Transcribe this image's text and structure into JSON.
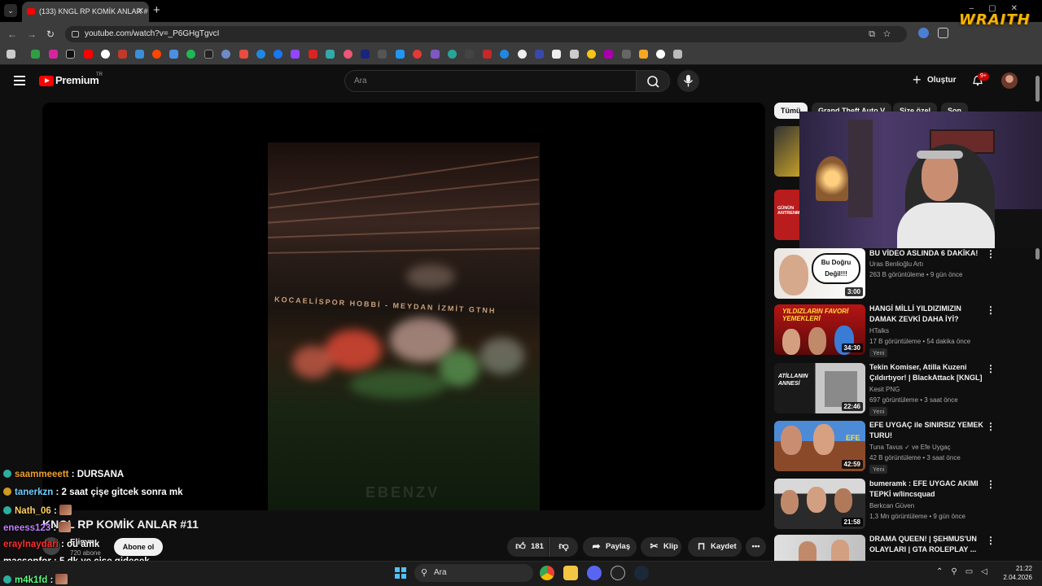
{
  "browser": {
    "tab_title": "(133) KNGL RP KOMİK ANLAR #",
    "url": "youtube.com/watch?v=_P6GHgTgvcI"
  },
  "overlay": {
    "wraith_logo": "WRAITH"
  },
  "youtube": {
    "logo_text": "Premium",
    "country_code": "TR",
    "search_placeholder": "Ara",
    "create_label": "Oluştur",
    "notification_badge": "9+"
  },
  "video": {
    "title": "KNGL RP KOMİK ANLAR #11",
    "banner_text": "KOCAELİSPOR HOBBİ - MEYDAN İZMİT GTNH",
    "channel": "Elimm",
    "subscribers": "720 abone",
    "subscribe_label": "Abone ol",
    "likes": "181",
    "share_label": "Paylaş",
    "clip_label": "Klip",
    "save_label": "Kaydet"
  },
  "chat": [
    {
      "user": "saammeeett",
      "message": ": DURSANA",
      "color": "#f0a030",
      "badge": "#2bb0a0"
    },
    {
      "user": "tanerkzn",
      "message": ": 2 saat çişe gitcek sonra mk",
      "color": "#70d0ff",
      "badge": "#d09a20"
    },
    {
      "user": "Nath_06",
      "message": ":",
      "color": "#ffd060",
      "badge": "#2bb0a0",
      "emote": true
    },
    {
      "user": "eneess123",
      "message": ":",
      "color": "#c080ff",
      "badge": "",
      "emote": true
    },
    {
      "user": "eraylnaydari",
      "message": ": ou amk",
      "color": "#ff3030",
      "badge": ""
    },
    {
      "user": "macsonfor",
      "message": ": 5 dk ye çişe gidecek",
      "color": "#ffffff",
      "badge": ""
    },
    {
      "user": "m4k1fd",
      "message": ":",
      "color": "#60ff80",
      "badge": "#2bb0a0",
      "emote": true
    }
  ],
  "chips": [
    "Tümü",
    "Grand Theft Auto V",
    "Size özel",
    "Son"
  ],
  "recommendations": [
    {
      "title": "BU VİDEO ASLINDA 6 DAKİKA!",
      "thumb_text": "Bu Doğru Değil!!!",
      "channel": "Uras Benlioğlu Artı",
      "meta": "263 B görüntüleme • 9 gün önce",
      "duration": "3:00",
      "new": ""
    },
    {
      "title": "HANGİ MİLLİ YILDIZIMIZIN DAMAK ZEVKİ DAHA İYİ? (TES...",
      "thumb_text": "YILDIZLARIN FAVORİ YEMEKLERİ",
      "channel": "HTalks",
      "meta": "17 B görüntüleme • 54 dakika önce",
      "duration": "34:30",
      "new": "Yeni"
    },
    {
      "title": "Tekin Komiser, Atilla Kuzeni Çıldırtıyor! | BlackAttack [KNGL]",
      "thumb_text": "ATİLLANIN ANNESİ",
      "channel": "Kesit PNG",
      "meta": "697 görüntüleme • 3 saat önce",
      "duration": "22:46",
      "new": "Yeni"
    },
    {
      "title": "EFE UYGAÇ ile SINIRSIZ YEMEK TURU!",
      "thumb_text": "EFE",
      "channel": "Tuna Tavus ✓ ve Efe Uygaç",
      "meta": "42 B görüntüleme • 3 saat önce",
      "duration": "42:59",
      "new": "Yeni"
    },
    {
      "title": "bumeramk : EFE UYGAC AKIMI TEPKİ w/lincsquad",
      "thumb_text": "",
      "channel": "Berkcan Güven",
      "meta": "1,3 Mn görüntüleme • 9 gün önce",
      "duration": "21:58",
      "new": ""
    },
    {
      "title": "DRAMA QUEEN! | ŞEHMUS'UN OLAYLARI | GTA ROLEPLAY ...",
      "thumb_text": "",
      "channel": "",
      "meta": "",
      "duration": "",
      "new": ""
    }
  ],
  "partial_thumbs": [
    {
      "thumb_text": "GÜNÜN ANTRENMANI"
    }
  ],
  "taskbar": {
    "search_placeholder": "Ara",
    "time": "21:22",
    "date": "2.04.2026"
  }
}
